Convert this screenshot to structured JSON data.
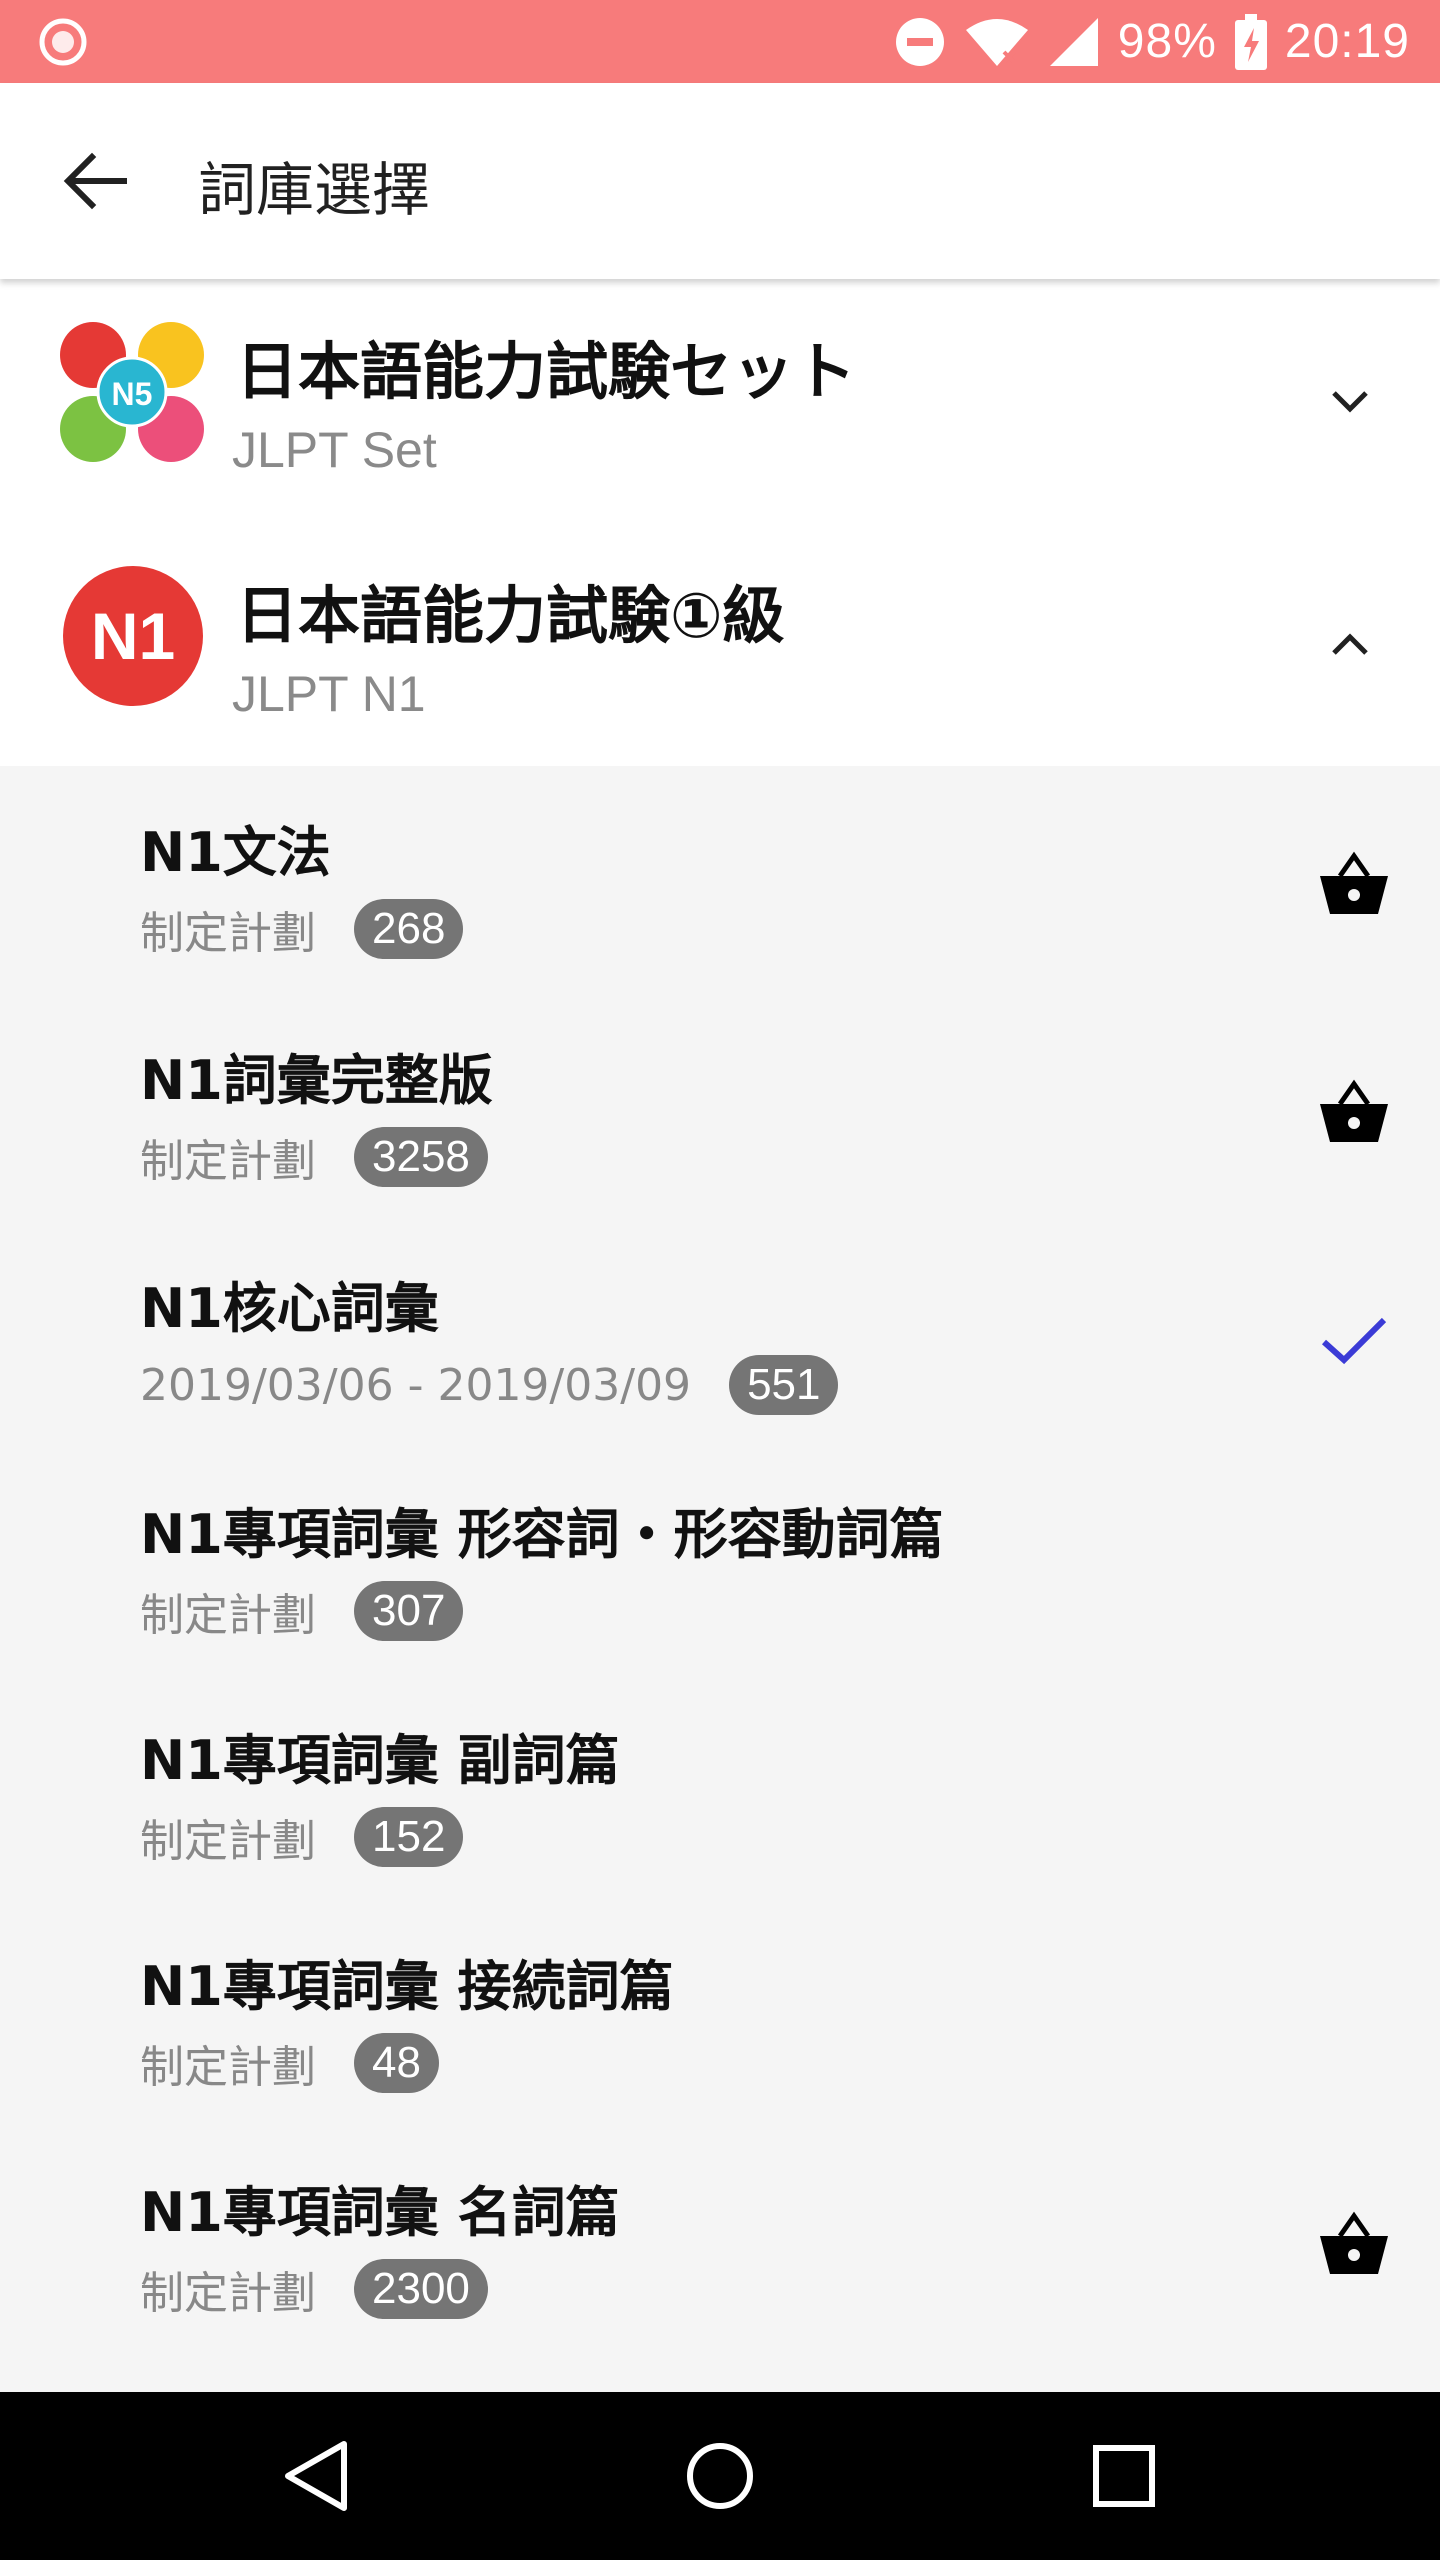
{
  "status_bar": {
    "battery": "98%",
    "time": "20:19",
    "accent": "#f77b7b"
  },
  "app_bar": {
    "title": "詞庫選擇"
  },
  "groups": [
    {
      "title": "日本語能力試験セット",
      "subtitle": "JLPT Set",
      "expanded": false
    },
    {
      "title": "日本語能力試験①級",
      "subtitle": "JLPT N1",
      "expanded": true
    }
  ],
  "items": [
    {
      "title": "N1文法",
      "sub": "制定計劃",
      "count": "268",
      "action": "basket-icon"
    },
    {
      "title": "N1詞彙完整版",
      "sub": "制定計劃",
      "count": "3258",
      "action": "basket-icon"
    },
    {
      "title": "N1核心詞彙",
      "sub": "2019/03/06 - 2019/03/09",
      "count": "551",
      "action": "check-icon"
    },
    {
      "title": "N1專項詞彙 形容詞・形容動詞篇",
      "sub": "制定計劃",
      "count": "307",
      "action": ""
    },
    {
      "title": "N1專項詞彙 副詞篇",
      "sub": "制定計劃",
      "count": "152",
      "action": ""
    },
    {
      "title": "N1專項詞彙 接続詞篇",
      "sub": "制定計劃",
      "count": "48",
      "action": ""
    },
    {
      "title": "N1專項詞彙 名詞篇",
      "sub": "制定計劃",
      "count": "2300",
      "action": "basket-icon"
    }
  ],
  "colors": {
    "check": "#3b3bd6",
    "badge": "#757575",
    "n1_logo": "#e53935"
  }
}
